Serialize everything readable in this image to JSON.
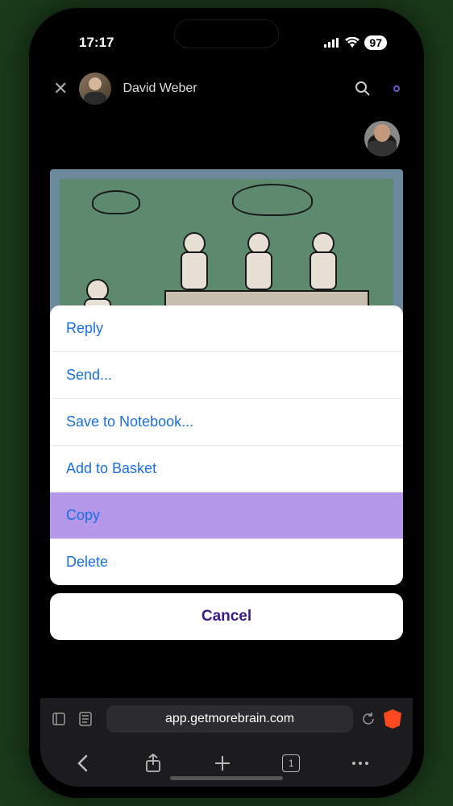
{
  "status": {
    "time": "17:17",
    "battery": "97"
  },
  "header": {
    "name": "David Weber"
  },
  "actionSheet": {
    "items": [
      {
        "label": "Reply",
        "highlighted": false
      },
      {
        "label": "Send...",
        "highlighted": false
      },
      {
        "label": "Save to Notebook...",
        "highlighted": false
      },
      {
        "label": "Add to Basket",
        "highlighted": false
      },
      {
        "label": "Copy",
        "highlighted": true
      },
      {
        "label": "Delete",
        "highlighted": false
      }
    ],
    "cancel": "Cancel"
  },
  "browser": {
    "url": "app.getmorebrain.com",
    "tabCount": "1"
  }
}
